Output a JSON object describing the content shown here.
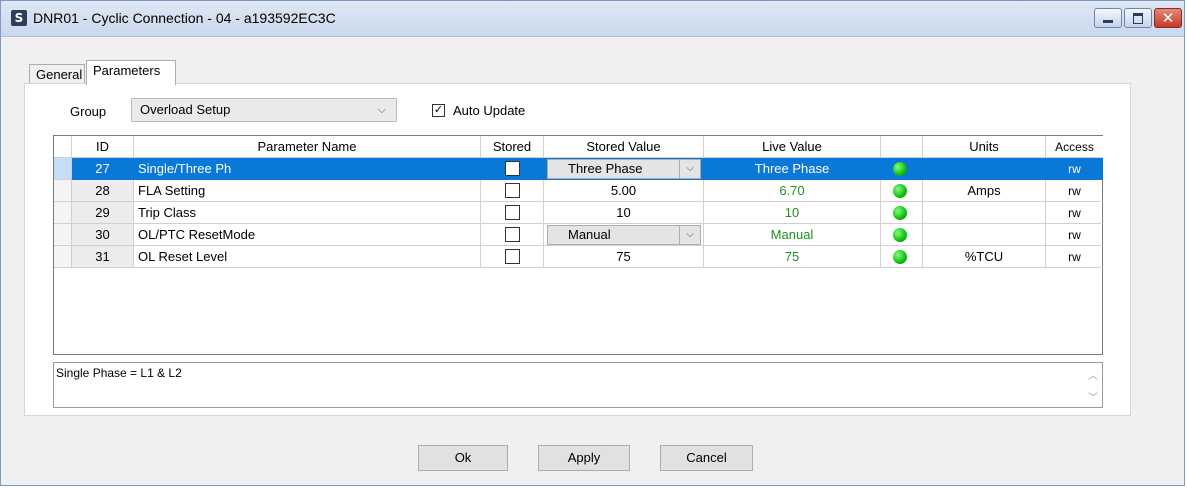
{
  "window": {
    "app_icon": "S",
    "title": "DNR01 - Cyclic Connection - 04 - a193592EC3C",
    "close_glyph": "✕"
  },
  "tabs": [
    {
      "label": "General",
      "active": false
    },
    {
      "label": "Parameters",
      "active": true
    }
  ],
  "group": {
    "label": "Group",
    "selected": "Overload Setup",
    "chevron": "⌵"
  },
  "auto_update": {
    "label": "Auto Update",
    "checked": true,
    "check_glyph": "✓"
  },
  "grid": {
    "columns": [
      "ID",
      "Parameter Name",
      "Stored",
      "Stored Value",
      "Live Value",
      "",
      "Units",
      "Access"
    ],
    "rows": [
      {
        "id": "27",
        "name": "Single/Three Ph",
        "stored_value": "Three Phase",
        "live_value": "Three Phase",
        "units": "",
        "access": "rw",
        "combo": true,
        "selected": true
      },
      {
        "id": "28",
        "name": "FLA Setting",
        "stored_value": "5.00",
        "live_value": "6.70",
        "units": "Amps",
        "access": "rw",
        "combo": false,
        "selected": false
      },
      {
        "id": "29",
        "name": "Trip Class",
        "stored_value": "10",
        "live_value": "10",
        "units": "",
        "access": "rw",
        "combo": false,
        "selected": false
      },
      {
        "id": "30",
        "name": "OL/PTC ResetMode",
        "stored_value": "Manual",
        "live_value": "Manual",
        "units": "",
        "access": "rw",
        "combo": true,
        "selected": false
      },
      {
        "id": "31",
        "name": "OL Reset Level",
        "stored_value": "75",
        "live_value": "75",
        "units": "%TCU",
        "access": "rw",
        "combo": false,
        "selected": false
      }
    ],
    "status_color": "#1ec71e",
    "selection_color": "#0a78d7"
  },
  "description": {
    "text": "Single Phase = L1 & L2",
    "scroll_up": "︿",
    "scroll_down": "﹀"
  },
  "buttons": {
    "ok": "Ok",
    "apply": "Apply",
    "cancel": "Cancel"
  }
}
